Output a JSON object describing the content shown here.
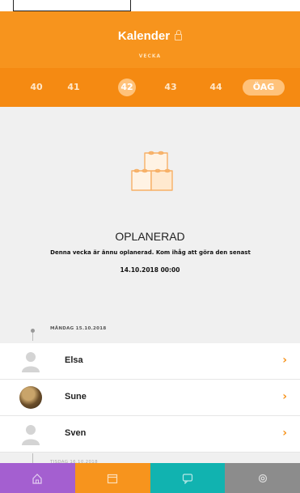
{
  "header": {
    "title": "Kalender",
    "subtitle": "VECKA",
    "weeks": [
      "40",
      "41",
      "42",
      "43",
      "44",
      "ÖAG"
    ],
    "selected_week": "42",
    "color": "#f7941d"
  },
  "content": {
    "status": "OPLANERAD",
    "description": "Denna vecka är ännu oplanerad. Kom ihåg att göra den senast",
    "deadline": "14.10.2018 00:00",
    "day_label": "MÅNDAG 15.10.2018",
    "next_day_label": "TISDAG 16.10.2018",
    "people": [
      {
        "name": "Elsa",
        "avatar": "default-avatar-icon"
      },
      {
        "name": "Sune",
        "avatar": "photo-avatar"
      },
      {
        "name": "Sven",
        "avatar": "default-avatar-icon"
      }
    ]
  },
  "nav": {
    "items": [
      {
        "icon": "home-icon",
        "color": "#a45fd0"
      },
      {
        "icon": "calendar-icon",
        "color": "#f7941d"
      },
      {
        "icon": "chat-icon",
        "color": "#11b3b0"
      },
      {
        "icon": "settings-icon",
        "color": "#8c8c8c"
      }
    ]
  }
}
